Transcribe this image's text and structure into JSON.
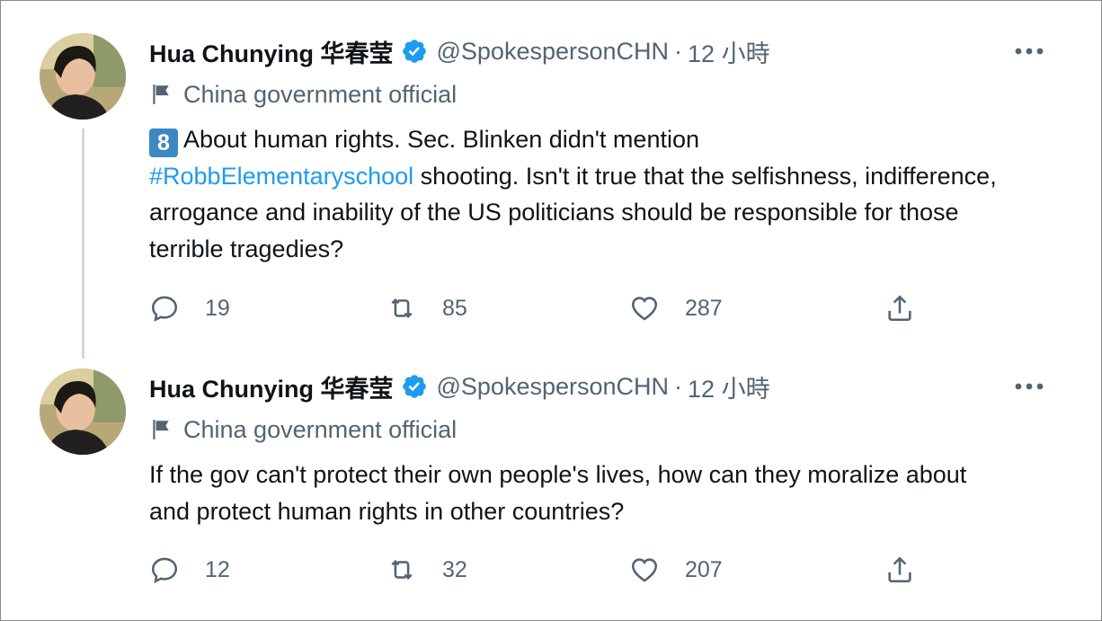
{
  "tweets": [
    {
      "author_name": "Hua Chunying 华春莹",
      "handle": "@SpokespersonCHN",
      "separator": "·",
      "time": "12 小時",
      "label": "China government official",
      "keycap": "8",
      "text_part1": "About human rights. Sec. Blinken didn't mention ",
      "hashtag": "#RobbElementaryschool",
      "text_part2": " shooting. Isn't it true that the selfishness, indifference, arrogance and inability of the US politicians should be responsible for those terrible tragedies?",
      "replies": "19",
      "retweets": "85",
      "likes": "287"
    },
    {
      "author_name": "Hua Chunying 华春莹",
      "handle": "@SpokespersonCHN",
      "separator": "·",
      "time": "12 小時",
      "label": "China government official",
      "text": "If the gov can't protect their own people's lives, how can they moralize about and protect human rights in other countries?",
      "replies": "12",
      "retweets": "32",
      "likes": "207"
    }
  ],
  "icons": {
    "verified": "verified-badge-icon",
    "more": "more-options-icon",
    "flag": "government-flag-icon",
    "reply": "reply-icon",
    "retweet": "retweet-icon",
    "like": "like-icon",
    "share": "share-icon"
  },
  "colors": {
    "accent": "#1d9bf0",
    "secondary_text": "#536471",
    "primary_text": "#0f1419",
    "thread_line": "#cfd9de"
  }
}
